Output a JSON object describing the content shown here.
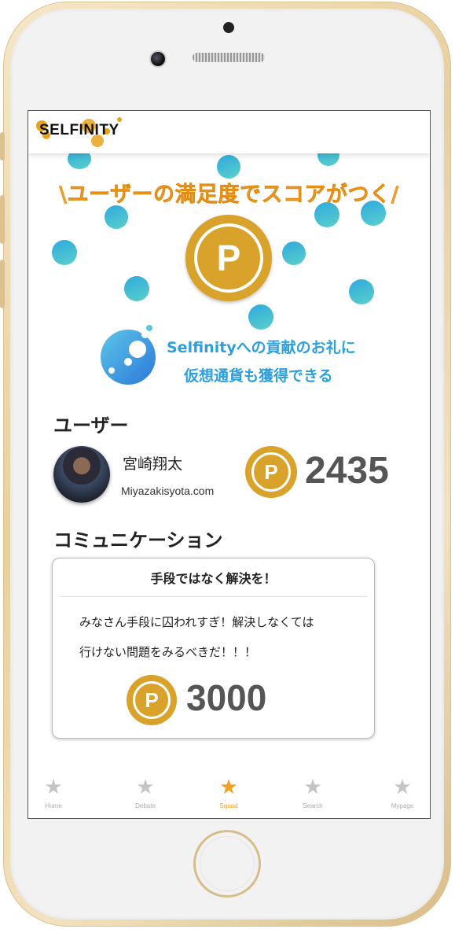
{
  "app": {
    "logo_text": "SELFINITY",
    "brand_color": "#e9a21c",
    "accent_blue": "#2d9fdb",
    "coin_color": "#d9a32b"
  },
  "promo": {
    "headline": "\\ユーザーの満足度でスコアがつく/",
    "coin_symbol": "P",
    "line1": "Selfinityへの貢献のお礼に",
    "line2": "仮想通貨も獲得できる"
  },
  "user_section": {
    "title": "ユーザー",
    "name": "宮崎翔太",
    "site": "Miyazakisyota.com",
    "coin_symbol": "P",
    "score": "2435"
  },
  "communication_section": {
    "title": "コミュニケーション",
    "card": {
      "title": "手段ではなく解決を！",
      "body_line1": "みなさん手段に囚われすぎ！解決しなくては",
      "body_line2": "行けない問題をみるべきだ！！！",
      "coin_symbol": "P",
      "reward": "3000"
    }
  },
  "tabbar": {
    "items": [
      {
        "label": "Home",
        "icon": "star-icon",
        "active": false
      },
      {
        "label": "Debate",
        "icon": "star-icon",
        "active": false
      },
      {
        "label": "Squad",
        "icon": "star-icon",
        "active": true
      },
      {
        "label": "Search",
        "icon": "star-icon",
        "active": false
      },
      {
        "label": "Mypage",
        "icon": "star-icon",
        "active": false
      }
    ],
    "active_color": "#f2a020",
    "inactive_color": "#c4c4c4"
  }
}
